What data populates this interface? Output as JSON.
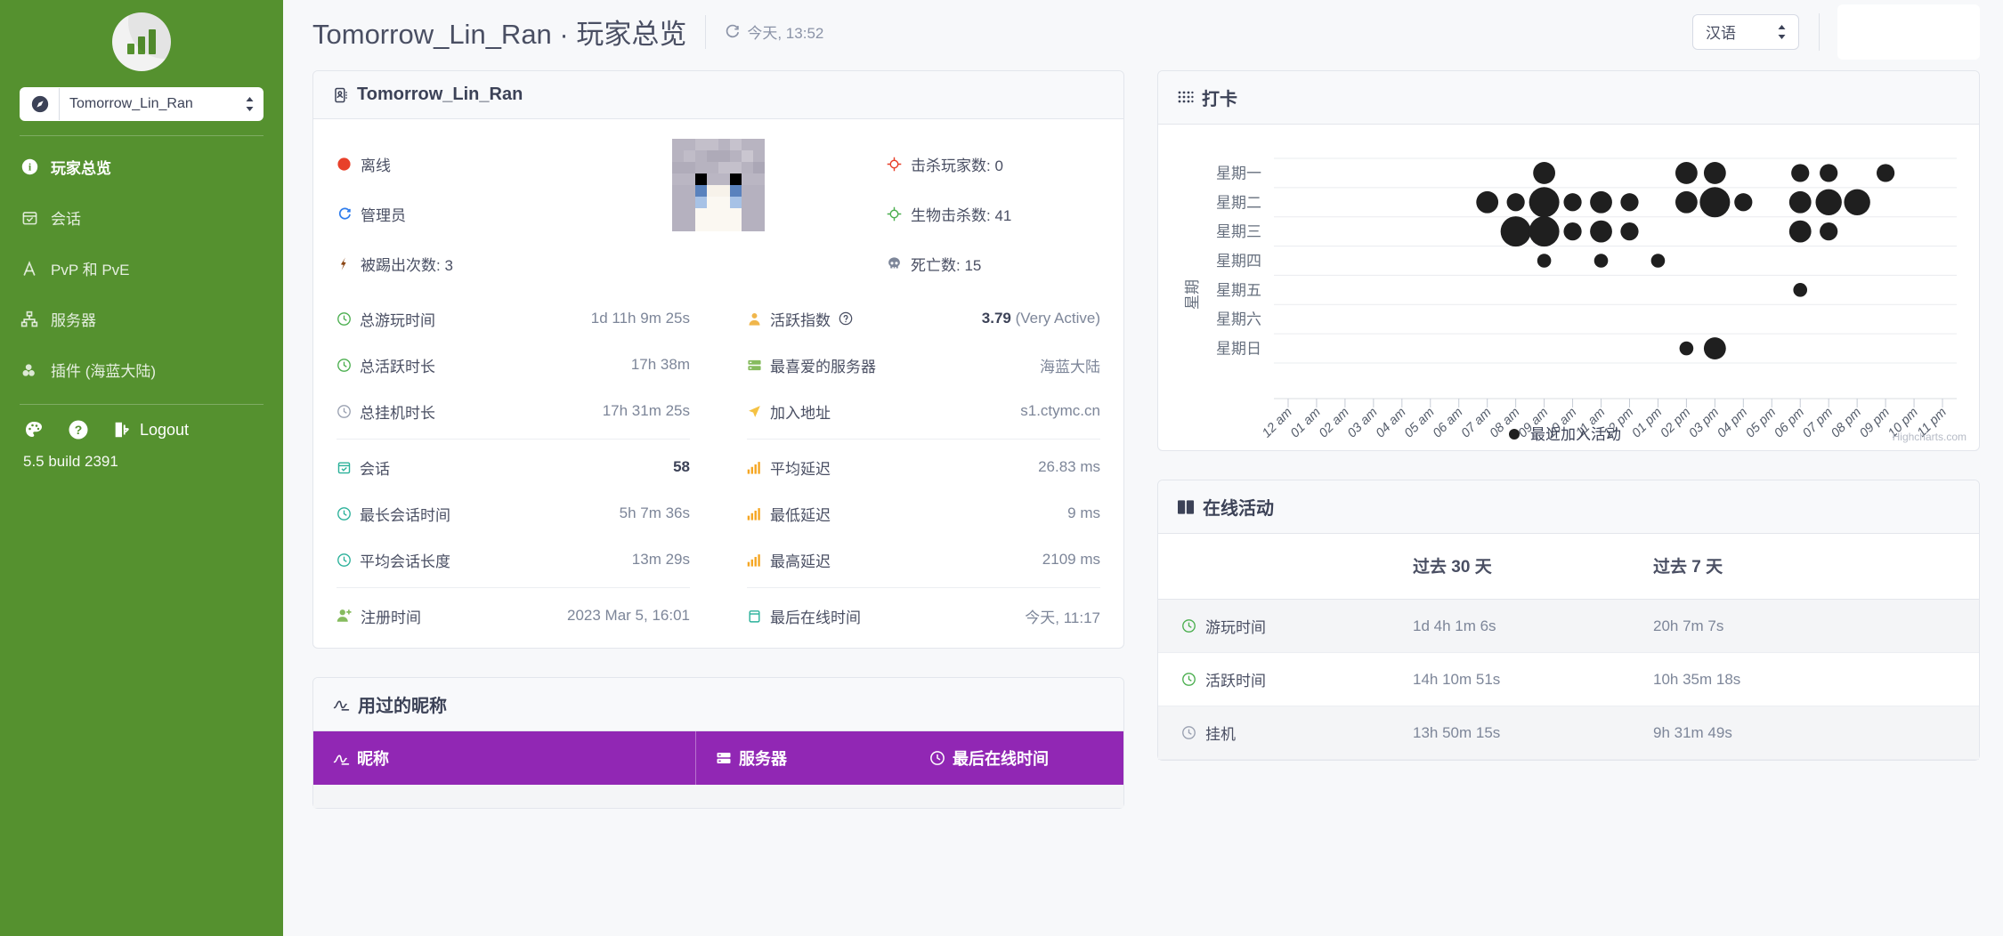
{
  "sidebar": {
    "logo_name": "chart-logo",
    "server_selector": {
      "value": "Tomorrow_Lin_Ran",
      "icon": "compass-icon"
    },
    "items": [
      {
        "label": "玩家总览",
        "icon": "info-icon",
        "active": true
      },
      {
        "label": "会话",
        "icon": "calendar-check-icon",
        "active": false
      },
      {
        "label": "PvP 和 PvE",
        "icon": "swords-icon",
        "active": false
      },
      {
        "label": "服务器",
        "icon": "sitemap-icon",
        "active": false
      },
      {
        "label": "插件 (海蓝大陆)",
        "icon": "plugin-icon",
        "active": false
      }
    ],
    "theme_icon": "palette-icon",
    "help_icon": "question-icon",
    "logout_label": "Logout",
    "logout_icon": "logout-icon",
    "version": "5.5 build 2391",
    "bg_color": "#55912f"
  },
  "topbar": {
    "title": "Tomorrow_Lin_Ran · 玩家总览",
    "refresh_icon": "refresh-icon",
    "refresh_text": "今天, 13:52",
    "language_value": "汉语"
  },
  "profile_card": {
    "title": "Tomorrow_Lin_Ran",
    "title_icon": "id-card-icon",
    "status": {
      "label": "离线",
      "icon": "circle-icon",
      "color": "#e8402a"
    },
    "rank": {
      "label": "管理员",
      "icon": "shield-icon",
      "color": "#2f7ded"
    },
    "kicks": {
      "label": "被踢出次数: 3",
      "icon": "boot-icon",
      "color": "#8b4513"
    },
    "player_kills": {
      "label": "击杀玩家数: 0",
      "icon": "crosshair-icon",
      "color": "#e8402a"
    },
    "mob_kills": {
      "label": "生物击杀数: 41",
      "icon": "crosshair-icon",
      "color": "#4caf50"
    },
    "deaths": {
      "label": "死亡数: 15",
      "icon": "skull-icon",
      "color": "#7d8699"
    },
    "avatar_name": "player-avatar",
    "stats_left_a": [
      {
        "label": "总游玩时间",
        "icon": "clock-green-icon",
        "value": "1d 11h 9m 25s"
      },
      {
        "label": "总活跃时长",
        "icon": "clock-green-icon",
        "value": "17h 38m"
      },
      {
        "label": "总挂机时长",
        "icon": "clock-grey-icon",
        "value": "17h 31m 25s"
      }
    ],
    "stats_right_a": [
      {
        "label": "活跃指数",
        "icon": "user-icon",
        "help": true,
        "value_bold": "3.79",
        "value": " (Very Active)"
      },
      {
        "label": "最喜爱的服务器",
        "icon": "server-icon",
        "value": "海蓝大陆"
      },
      {
        "label": "加入地址",
        "icon": "location-arrow-icon",
        "value": "s1.ctymc.cn"
      }
    ],
    "stats_left_b": [
      {
        "label": "会话",
        "icon": "calendar-check-icon",
        "value_bold": "58",
        "value": ""
      },
      {
        "label": "最长会话时间",
        "icon": "clock-teal-icon",
        "value": "5h 7m 36s"
      },
      {
        "label": "平均会话长度",
        "icon": "clock-teal-icon",
        "value": "13m 29s"
      }
    ],
    "stats_right_b": [
      {
        "label": "平均延迟",
        "icon": "signal-icon",
        "value": "26.83 ms"
      },
      {
        "label": "最低延迟",
        "icon": "signal-icon",
        "value": "9 ms"
      },
      {
        "label": "最高延迟",
        "icon": "signal-icon",
        "value": "2109 ms"
      }
    ],
    "stats_left_c": [
      {
        "label": "注册时间",
        "icon": "user-plus-icon",
        "value": "2023 Mar 5, 16:01"
      }
    ],
    "stats_right_c": [
      {
        "label": "最后在线时间",
        "icon": "calendar-icon",
        "value": "今天, 11:17"
      }
    ]
  },
  "nicknames_card": {
    "title": "用过的昵称",
    "title_icon": "signature-icon",
    "header_color": "#9127b4",
    "columns": [
      {
        "label": "昵称",
        "icon": "signature-icon"
      },
      {
        "label": "服务器",
        "icon": "server-icon"
      },
      {
        "label": "最后在线时间",
        "icon": "clock-icon"
      }
    ]
  },
  "punchcard_card": {
    "title": "打卡",
    "title_icon": "braille-icon",
    "credit": "Highcharts.com"
  },
  "online_activity_card": {
    "title": "在线活动",
    "title_icon": "book-icon",
    "columns": [
      "",
      "过去 30 天",
      "过去 7 天"
    ],
    "rows": [
      {
        "label": "游玩时间",
        "icon": "clock-green-icon",
        "d30": "1d 4h 1m 6s",
        "d7": "20h 7m 7s"
      },
      {
        "label": "活跃时间",
        "icon": "clock-green-icon",
        "d30": "14h 10m 51s",
        "d7": "10h 35m 18s"
      },
      {
        "label": "挂机",
        "icon": "clock-grey-icon",
        "d30": "13h 50m 15s",
        "d7": "9h 31m 49s"
      }
    ]
  },
  "chart_data": {
    "type": "scatter",
    "chart_kind": "punchcard",
    "title": "打卡",
    "xlabel": "",
    "ylabel": "星期",
    "legend": [
      "最近加入活动"
    ],
    "legend_position": "bottom",
    "grid": true,
    "xtick_labels": [
      "12 am",
      "01 am",
      "02 am",
      "03 am",
      "04 am",
      "05 am",
      "06 am",
      "07 am",
      "08 am",
      "09 am",
      "10 am",
      "11 am",
      "12 pm",
      "01 pm",
      "02 pm",
      "03 pm",
      "04 pm",
      "05 pm",
      "06 pm",
      "07 pm",
      "08 pm",
      "09 pm",
      "10 pm",
      "11 pm"
    ],
    "categories": [
      "星期一",
      "星期二",
      "星期三",
      "星期四",
      "星期五",
      "星期六",
      "星期日"
    ],
    "points": [
      {
        "day": 0,
        "hour": 9,
        "size": 3
      },
      {
        "day": 0,
        "hour": 14,
        "size": 3
      },
      {
        "day": 0,
        "hour": 15,
        "size": 3
      },
      {
        "day": 0,
        "hour": 18,
        "size": 2
      },
      {
        "day": 0,
        "hour": 19,
        "size": 2
      },
      {
        "day": 0,
        "hour": 21,
        "size": 2
      },
      {
        "day": 1,
        "hour": 7,
        "size": 3
      },
      {
        "day": 1,
        "hour": 8,
        "size": 2
      },
      {
        "day": 1,
        "hour": 9,
        "size": 5
      },
      {
        "day": 1,
        "hour": 10,
        "size": 2
      },
      {
        "day": 1,
        "hour": 11,
        "size": 3
      },
      {
        "day": 1,
        "hour": 12,
        "size": 2
      },
      {
        "day": 1,
        "hour": 14,
        "size": 3
      },
      {
        "day": 1,
        "hour": 15,
        "size": 5
      },
      {
        "day": 1,
        "hour": 16,
        "size": 2
      },
      {
        "day": 1,
        "hour": 18,
        "size": 3
      },
      {
        "day": 1,
        "hour": 19,
        "size": 4
      },
      {
        "day": 1,
        "hour": 20,
        "size": 4
      },
      {
        "day": 2,
        "hour": 8,
        "size": 5
      },
      {
        "day": 2,
        "hour": 9,
        "size": 5
      },
      {
        "day": 2,
        "hour": 10,
        "size": 2
      },
      {
        "day": 2,
        "hour": 11,
        "size": 3
      },
      {
        "day": 2,
        "hour": 12,
        "size": 2
      },
      {
        "day": 2,
        "hour": 18,
        "size": 3
      },
      {
        "day": 2,
        "hour": 19,
        "size": 2
      },
      {
        "day": 3,
        "hour": 9,
        "size": 1
      },
      {
        "day": 3,
        "hour": 11,
        "size": 1
      },
      {
        "day": 3,
        "hour": 13,
        "size": 1
      },
      {
        "day": 4,
        "hour": 18,
        "size": 1
      },
      {
        "day": 6,
        "hour": 14,
        "size": 1
      },
      {
        "day": 6,
        "hour": 15,
        "size": 3
      }
    ]
  }
}
